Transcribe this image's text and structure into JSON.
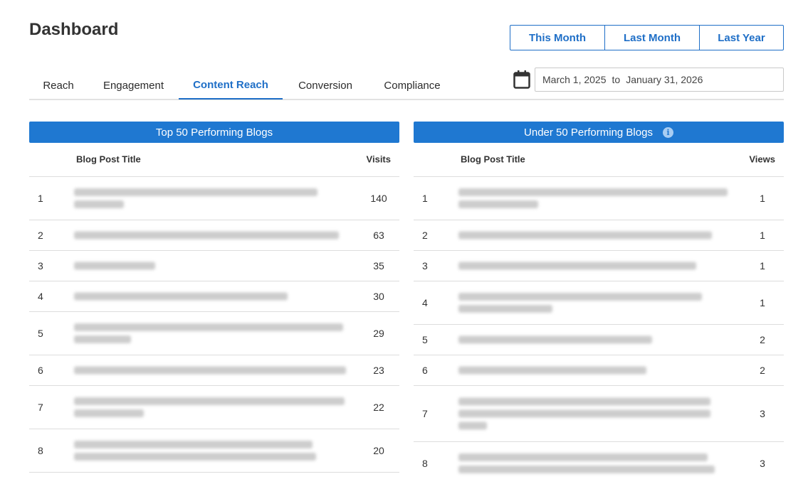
{
  "page": {
    "title": "Dashboard"
  },
  "date_range_buttons": [
    "This Month",
    "Last Month",
    "Last Year"
  ],
  "tabs": [
    {
      "label": "Reach",
      "active": false
    },
    {
      "label": "Engagement",
      "active": false
    },
    {
      "label": "Content Reach",
      "active": true
    },
    {
      "label": "Conversion",
      "active": false
    },
    {
      "label": "Compliance",
      "active": false
    }
  ],
  "date_filter": {
    "start": "March 1, 2025",
    "separator": "to",
    "end": "January 31, 2026"
  },
  "top_panel": {
    "title": "Top 50 Performing Blogs",
    "col_title": "Blog Post Title",
    "col_value": "Visits",
    "rows": [
      {
        "rank": "1",
        "value": "140"
      },
      {
        "rank": "2",
        "value": "63"
      },
      {
        "rank": "3",
        "value": "35"
      },
      {
        "rank": "4",
        "value": "30"
      },
      {
        "rank": "5",
        "value": "29"
      },
      {
        "rank": "6",
        "value": "23"
      },
      {
        "rank": "7",
        "value": "22"
      },
      {
        "rank": "8",
        "value": "20"
      }
    ]
  },
  "under_panel": {
    "title": "Under 50 Performing Blogs",
    "col_title": "Blog Post Title",
    "col_value": "Views",
    "rows": [
      {
        "rank": "1",
        "value": "1"
      },
      {
        "rank": "2",
        "value": "1"
      },
      {
        "rank": "3",
        "value": "1"
      },
      {
        "rank": "4",
        "value": "1"
      },
      {
        "rank": "5",
        "value": "2"
      },
      {
        "rank": "6",
        "value": "2"
      },
      {
        "rank": "7",
        "value": "3"
      },
      {
        "rank": "8",
        "value": "3"
      }
    ]
  },
  "colors": {
    "accent": "#1f78d1",
    "accent_text": "#1f6fc7",
    "divider": "#dddddd"
  },
  "icons": {
    "calendar": "calendar-icon",
    "info": "info-icon"
  }
}
